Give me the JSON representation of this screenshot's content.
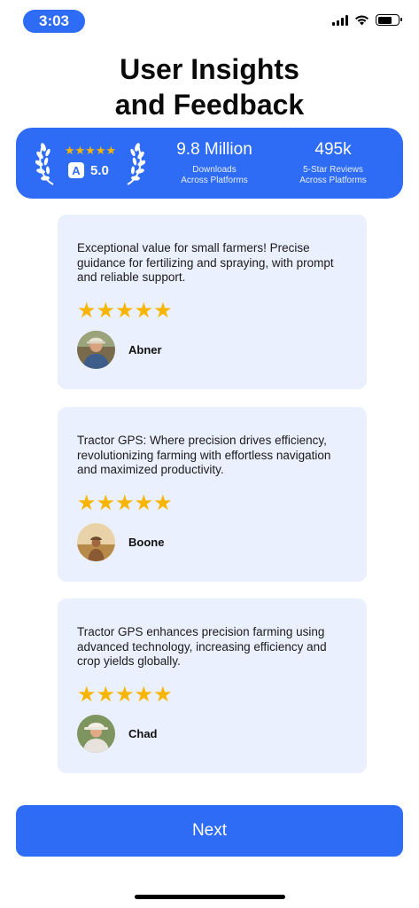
{
  "status_bar": {
    "time": "3:03"
  },
  "title": {
    "line1": "User Insights",
    "line2": "and Feedback"
  },
  "stats": {
    "stars": "★★★★★",
    "rating": "5.0",
    "downloads": {
      "value": "9.8 Million",
      "label_line1": "Downloads",
      "label_line2": "Across Platforms"
    },
    "reviews": {
      "value": "495k",
      "label_line1": "5-Star Reviews",
      "label_line2": "Across Platforms"
    }
  },
  "reviews": [
    {
      "text": "Exceptional value for small farmers! Precise guidance for fertilizing and spraying, with prompt and reliable support.",
      "stars": "★★★★★",
      "name": "Abner"
    },
    {
      "text": "Tractor GPS: Where precision drives efficiency, revolutionizing farming with effortless navigation and maximized productivity.",
      "stars": "★★★★★",
      "name": "Boone"
    },
    {
      "text": "Tractor GPS enhances precision farming using advanced technology, increasing efficiency and crop yields globally.",
      "stars": "★★★★★",
      "name": "Chad"
    }
  ],
  "next_button": {
    "label": "Next"
  },
  "colors": {
    "accent": "#2f6cf6",
    "card_bg": "#eaf0fd",
    "star": "#f7b500"
  }
}
